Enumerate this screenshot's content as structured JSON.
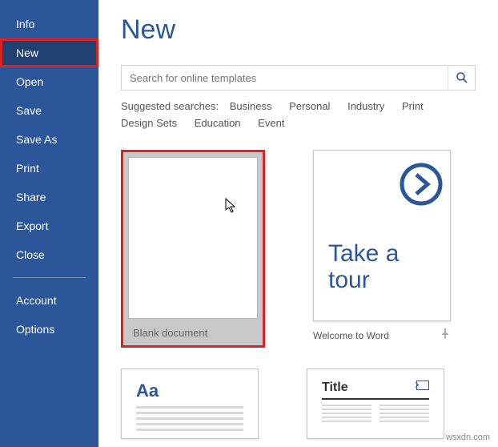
{
  "sidebar": {
    "items": [
      {
        "label": "Info"
      },
      {
        "label": "New"
      },
      {
        "label": "Open"
      },
      {
        "label": "Save"
      },
      {
        "label": "Save As"
      },
      {
        "label": "Print"
      },
      {
        "label": "Share"
      },
      {
        "label": "Export"
      },
      {
        "label": "Close"
      }
    ],
    "footer": [
      {
        "label": "Account"
      },
      {
        "label": "Options"
      }
    ]
  },
  "main": {
    "title": "New",
    "search_placeholder": "Search for online templates",
    "suggested_label": "Suggested searches:",
    "suggested": [
      "Business",
      "Personal",
      "Industry",
      "Print",
      "Design Sets",
      "Education",
      "Event"
    ],
    "templates": {
      "blank": "Blank document",
      "tour_line1": "Take a",
      "tour_line2": "tour",
      "tour_caption": "Welcome to Word",
      "row2_aa": "Aa",
      "row2_title": "Title"
    }
  },
  "watermark": "wsxdn.com",
  "colors": {
    "accent": "#2B579A",
    "highlight": "#e02020"
  }
}
